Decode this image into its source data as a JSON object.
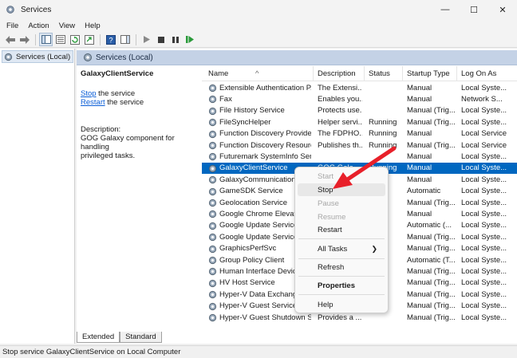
{
  "window": {
    "title": "Services",
    "minimize": "—",
    "maximize": "☐",
    "close": "✕"
  },
  "menu": [
    "File",
    "Action",
    "View",
    "Help"
  ],
  "tree": {
    "root_label": "Services (Local)"
  },
  "pane_header": "Services (Local)",
  "details": {
    "service_title": "GalaxyClientService",
    "stop_link": "Stop",
    "stop_suffix": " the service",
    "restart_link": "Restart",
    "restart_suffix": " the service",
    "description_label": "Description:",
    "description_line1": "GOG Galaxy component for handling",
    "description_line2": "privileged tasks."
  },
  "columns": [
    "Name",
    "Description",
    "Status",
    "Startup Type",
    "Log On As"
  ],
  "sort_indicator": "^",
  "rows": [
    [
      "Extensible Authentication P...",
      "The Extensi...",
      "",
      "Manual",
      "Local Syste..."
    ],
    [
      "Fax",
      "Enables you...",
      "",
      "Manual",
      "Network S..."
    ],
    [
      "File History Service",
      "Protects use...",
      "",
      "Manual (Trig...",
      "Local Syste..."
    ],
    [
      "FileSyncHelper",
      "Helper servi...",
      "Running",
      "Manual (Trig...",
      "Local Syste..."
    ],
    [
      "Function Discovery Provide...",
      "The FDPHO...",
      "Running",
      "Manual",
      "Local Service"
    ],
    [
      "Function Discovery Resourc...",
      "Publishes th...",
      "Running",
      "Manual (Trig...",
      "Local Service"
    ],
    [
      "Futuremark SystemInfo Ser...",
      "",
      "",
      "Manual",
      "Local Syste..."
    ],
    [
      "GalaxyClientService",
      "GOG Gala...",
      "Running",
      "Manual",
      "Local Syste..."
    ],
    [
      "GalaxyCommunication",
      "",
      "",
      "Manual",
      "Local Syste..."
    ],
    [
      "GameSDK Service",
      "",
      "",
      "Automatic",
      "Local Syste..."
    ],
    [
      "Geolocation Service",
      "",
      "",
      "Manual (Trig...",
      "Local Syste..."
    ],
    [
      "Google Chrome Elevation",
      "",
      "",
      "Manual",
      "Local Syste..."
    ],
    [
      "Google Update Service (",
      "",
      "",
      "Automatic (...",
      "Local Syste..."
    ],
    [
      "Google Update Service (",
      "",
      "",
      "Manual (Trig...",
      "Local Syste..."
    ],
    [
      "GraphicsPerfSvc",
      "",
      "",
      "Manual (Trig...",
      "Local Syste..."
    ],
    [
      "Group Policy Client",
      "",
      "",
      "Automatic (T...",
      "Local Syste..."
    ],
    [
      "Human Interface Device",
      "",
      "",
      "Manual (Trig...",
      "Local Syste..."
    ],
    [
      "HV Host Service",
      "",
      "",
      "Manual (Trig...",
      "Local Syste..."
    ],
    [
      "Hyper-V Data Exchange",
      "",
      "",
      "Manual (Trig...",
      "Local Syste..."
    ],
    [
      "Hyper-V Guest Service In",
      "",
      "",
      "Manual (Trig...",
      "Local Syste..."
    ],
    [
      "Hyper-V Guest Shutdown S...",
      "Provides a ...",
      "",
      "Manual (Trig...",
      "Local Syste..."
    ]
  ],
  "context_menu": {
    "start": "Start",
    "stop": "Stop",
    "pause": "Pause",
    "resume": "Resume",
    "restart": "Restart",
    "all_tasks": "All Tasks",
    "refresh": "Refresh",
    "properties": "Properties",
    "help": "Help",
    "submenu_arrow": "❯"
  },
  "tabs": {
    "extended": "Extended",
    "standard": "Standard"
  },
  "status_text": "Stop service GalaxyClientService on Local Computer",
  "colors": {
    "selection": "#0067c0",
    "arrow": "#e8202a",
    "header_bar": "#c4d2e6"
  }
}
